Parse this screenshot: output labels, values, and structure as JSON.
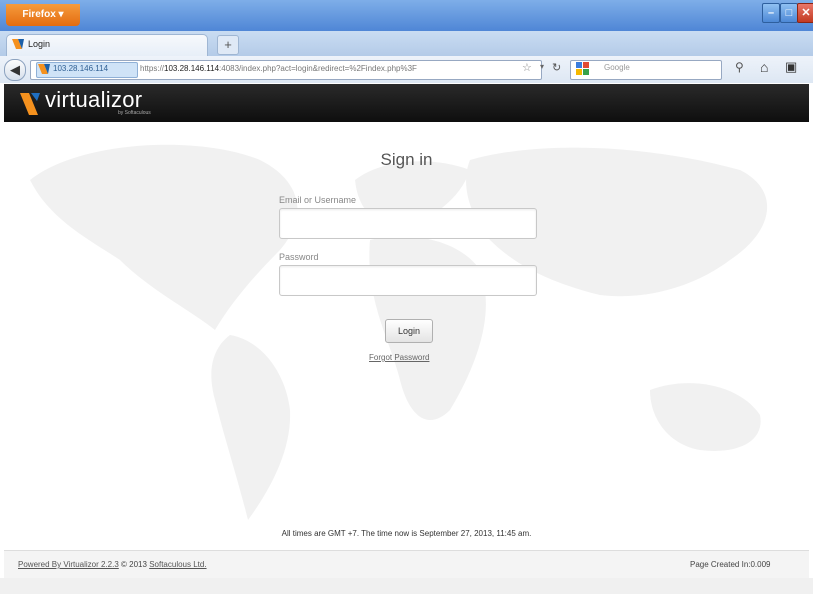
{
  "browser": {
    "app_button": "Firefox",
    "tab_title": "Login",
    "url_identity": "103.28.146.114",
    "url_scheme": "https://",
    "url_host": "103.28.146.114",
    "url_path": ":4083/index.php?act=login&redirect=%2Findex.php%3F",
    "search_placeholder": "Google",
    "icons": {
      "back": "back-arrow-icon",
      "star": "bookmark-star-icon",
      "reload": "reload-icon",
      "search": "magnifier-icon",
      "home": "home-icon",
      "more": "menu-icon"
    }
  },
  "header": {
    "logo_text": "virtualizor",
    "logo_sub": "by Softaculous",
    "brand_color": "#f5911e"
  },
  "login": {
    "title": "Sign in",
    "email_label": "Email or Username",
    "email_value": "",
    "password_label": "Password",
    "password_value": "",
    "login_button": "Login",
    "forgot_link": "Forgot Password"
  },
  "footer": {
    "time_note": "All times are GMT +7. The time now is September 27, 2013, 11:45 am.",
    "powered_by_link": "Powered By Virtualizor 2.2.3",
    "copyright_prefix": "© 2013",
    "company_link": "Softaculous Ltd.",
    "page_created": "Page Created In:0.009"
  }
}
